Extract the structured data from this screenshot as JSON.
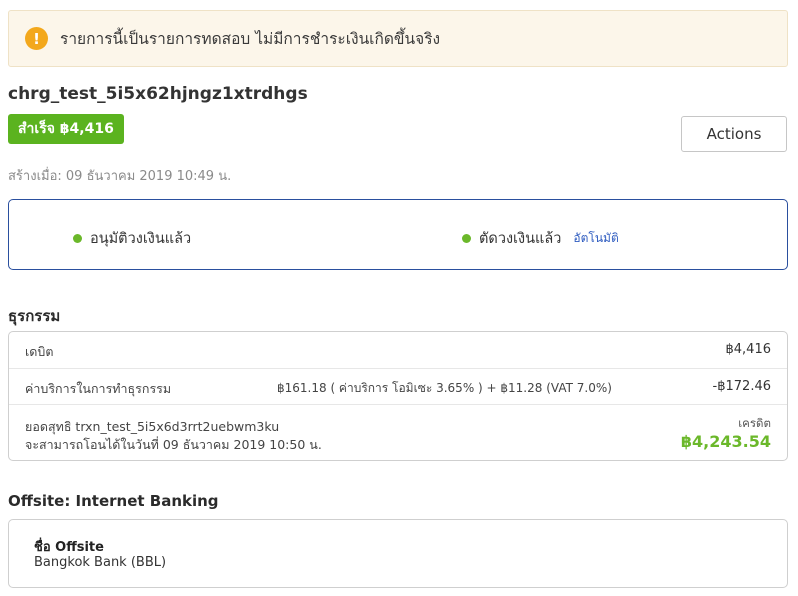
{
  "banner": {
    "icon": "exclamation-icon",
    "icon_glyph": "!",
    "text": "รายการนี้เป็นรายการทดสอบ ไม่มีการชำระเงินเกิดขึ้นจริง"
  },
  "charge": {
    "id": "chrg_test_5i5x62hjngz1xtrdhgs",
    "status_badge": "สำเร็จ ฿4,416",
    "created_at": "สร้างเมื่อ: 09 ธันวาคม 2019 10:49 น.",
    "actions_label": "Actions"
  },
  "status_steps": {
    "authorized": "อนุมัติวงเงินแล้ว",
    "captured": "ตัดวงเงินแล้ว",
    "captured_note": "อัตโนมัติ"
  },
  "transactions": {
    "title": "ธุรกรรม",
    "debit_label": "เดบิต",
    "debit_amount": "฿4,416",
    "fee_label": "ค่าบริการในการทำธุรกรรม",
    "fee_detail": "฿161.18 ( ค่าบริการ โอมิเซะ 3.65% ) + ฿11.28 (VAT 7.0%)",
    "fee_amount": "-฿172.46",
    "net_label": "ยอดสุทธิ trxn_test_5i5x6d3rrt2uebwm3ku",
    "net_transfer": "จะสามารถโอนได้ในวันที่ 09 ธันวาคม 2019 10:50 น.",
    "credit_label": "เครดิต",
    "credit_amount": "฿4,243.54"
  },
  "offsite": {
    "title": "Offsite: Internet Banking",
    "name_label": "ชื่อ Offsite",
    "name_value": "Bangkok Bank (BBL)"
  },
  "colors": {
    "success": "#5bb31f",
    "warning": "#f3a81c",
    "link": "#2f5cc0",
    "card_border": "#2a4f9e"
  }
}
